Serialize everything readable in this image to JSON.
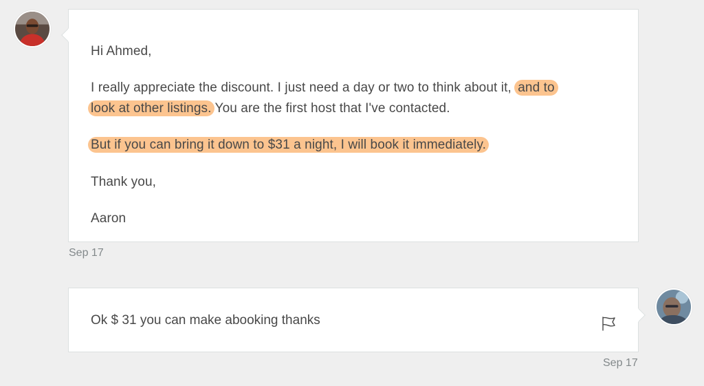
{
  "thread": {
    "messages": [
      {
        "sender_avatar": "avatar-aaron",
        "greeting": "Hi Ahmed,",
        "body_line1_plain": "I really appreciate the discount. I just need a day or two to think about it,",
        "body_line1_highlight": "and to",
        "body_line2_highlight": "look at other listings.",
        "body_line2_plain": "You are the first host that I've contacted.",
        "body_line3_highlight": "But if you can bring it down to $31 a night, I will book it immediately.",
        "thanks": "Thank you,",
        "signature": "Aaron",
        "timestamp": "Sep 17"
      },
      {
        "sender_avatar": "avatar-ahmed",
        "text": "Ok  $ 31 you can make abooking thanks",
        "flag_icon": "flag-icon",
        "timestamp": "Sep 17"
      }
    ]
  },
  "colors": {
    "background": "#efefef",
    "bubble": "#ffffff",
    "bubble_border": "#dce0e0",
    "highlight": "#fcc48f",
    "text": "#484848",
    "timestamp": "#82888a"
  }
}
